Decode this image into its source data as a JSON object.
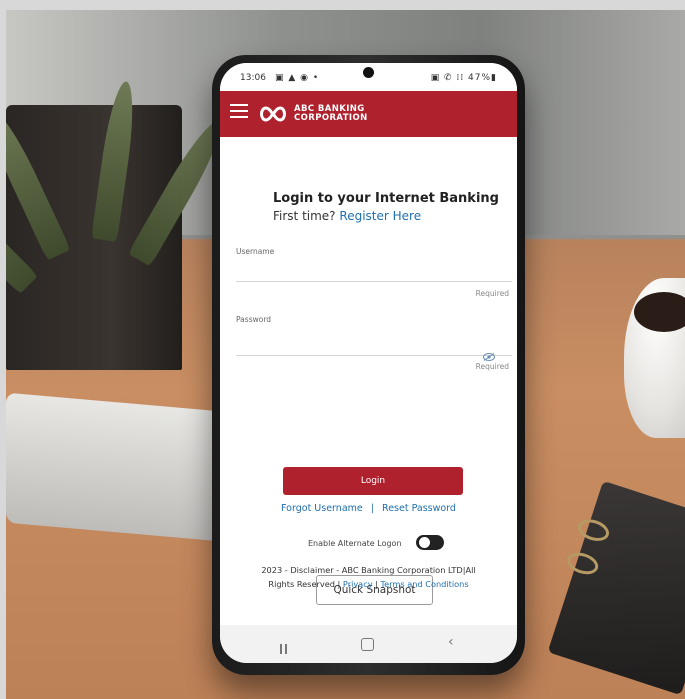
{
  "status_bar": {
    "time": "13:06",
    "left_icons": "▣ ▲ ◉ •",
    "right_icons": "▣ ✆ ⁞⁞ 47%▮"
  },
  "app_bar": {
    "brand_line1": "ABC BANKING",
    "brand_line2": "CORPORATION",
    "accent_color": "#b0212e"
  },
  "login": {
    "title": "Login to your Internet Banking",
    "first_time": "First time?",
    "register_link": "Register Here",
    "username_label": "Username",
    "username_value": "",
    "username_required": "Required",
    "password_label": "Password",
    "password_value": "",
    "password_required": "Required",
    "login_button": "Login",
    "forgot_username": "Forgot Username",
    "separator": "|",
    "reset_password": "Reset Password",
    "alt_logon_label": "Enable Alternate Logon",
    "alt_logon_enabled": false,
    "quick_snapshot": "Quick Snapshot"
  },
  "footer": {
    "line1": "2023 - Disclaimer - ABC Banking Corporation LTD|All",
    "line2_prefix": "Rights Reserved |",
    "privacy": "Privacy",
    "sep": "|",
    "terms": "Terms and Conditions"
  },
  "icons": {
    "menu": "hamburger-icon",
    "logo": "infinity-logo-icon",
    "eye": "eye-icon",
    "recent": "recent-apps-icon",
    "home": "home-icon",
    "back": "back-icon"
  }
}
